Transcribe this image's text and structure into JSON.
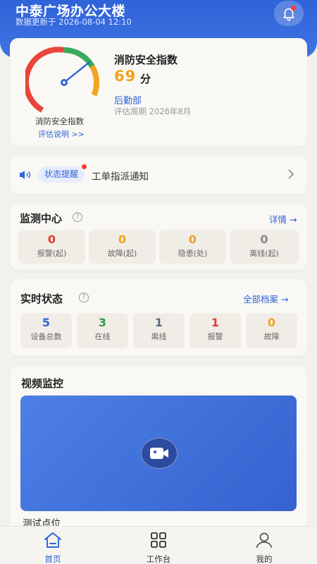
{
  "header": {
    "title": "中泰广场办公大楼",
    "updated": "数据更新于 2026-08-04 12:10"
  },
  "score": {
    "gauge_label": "消防安全指数",
    "explain_link": "评估说明 >>",
    "title": "消防安全指数",
    "value": "69",
    "unit": "分",
    "value_fraction": 0.69,
    "department": "后勤部",
    "period": "评估周期 2026年8月"
  },
  "notice": {
    "tag": "状态提醒",
    "text": "工单指派通知"
  },
  "monitor": {
    "title": "监测中心",
    "help": "?",
    "link": "详情 →",
    "stats": [
      {
        "value": "0",
        "label": "报警(起)",
        "color": "#e23b2e"
      },
      {
        "value": "0",
        "label": "故障(起)",
        "color": "#f0a21a"
      },
      {
        "value": "0",
        "label": "隐患(处)",
        "color": "#e8a224"
      },
      {
        "value": "0",
        "label": "离线(起)",
        "color": "#888888"
      }
    ]
  },
  "realtime": {
    "title": "实时状态",
    "help": "?",
    "link": "全部档案 →",
    "stats": [
      {
        "value": "5",
        "label": "设备总数",
        "color": "#2f63d8"
      },
      {
        "value": "3",
        "label": "在线",
        "color": "#2e9a4f"
      },
      {
        "value": "1",
        "label": "离线",
        "color": "#5a6b80"
      },
      {
        "value": "1",
        "label": "报警",
        "color": "#e23b2e"
      },
      {
        "value": "0",
        "label": "故障",
        "color": "#f0a21a"
      }
    ]
  },
  "video": {
    "title": "视频监控",
    "camera_name": "测试点位"
  },
  "tabbar": {
    "tabs": [
      {
        "label": "首页",
        "icon": "home-icon",
        "active": true
      },
      {
        "label": "工作台",
        "icon": "grid-icon",
        "active": false
      },
      {
        "label": "我的",
        "icon": "user-icon",
        "active": false
      }
    ]
  },
  "colors": {
    "primary": "#2f63d8",
    "warning": "#f0a21a",
    "danger": "#e23b2e",
    "success": "#2e9a4f"
  }
}
